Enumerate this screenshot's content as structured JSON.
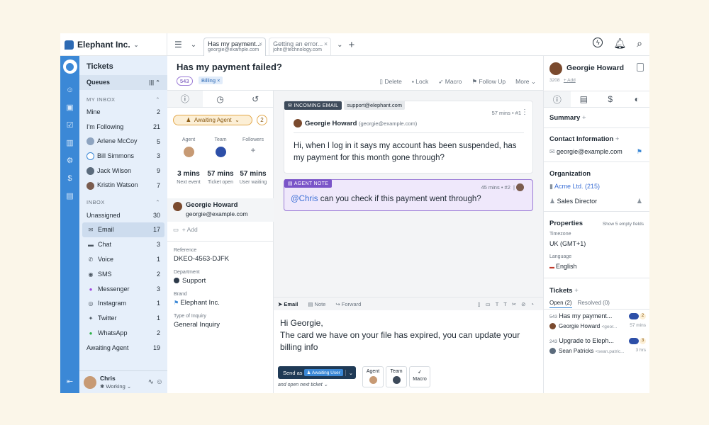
{
  "workspace": {
    "name": "Elephant Inc."
  },
  "tabs": [
    {
      "title": "Has my payment...",
      "subtitle": "georgie@example.com"
    },
    {
      "title": "Getting an error...",
      "subtitle": "john@technology.com"
    }
  ],
  "sidebar": {
    "title": "Tickets",
    "queues_label": "Queues",
    "my_inbox_label": "MY INBOX",
    "my_inbox": [
      {
        "label": "Mine",
        "count": "2"
      },
      {
        "label": "I'm Following",
        "count": "21"
      },
      {
        "label": "Arlene McCoy",
        "count": "5"
      },
      {
        "label": "Bill Simmons",
        "count": "3"
      },
      {
        "label": "Jack Wilson",
        "count": "9"
      },
      {
        "label": "Kristin Watson",
        "count": "7"
      }
    ],
    "inbox_label": "INBOX",
    "inbox": [
      {
        "label": "Unassigned",
        "count": "30"
      },
      {
        "label": "Email",
        "count": "17"
      },
      {
        "label": "Chat",
        "count": "3"
      },
      {
        "label": "Voice",
        "count": "1"
      },
      {
        "label": "SMS",
        "count": "2"
      },
      {
        "label": "Messenger",
        "count": "3"
      },
      {
        "label": "Instagram",
        "count": "1"
      },
      {
        "label": "Twitter",
        "count": "1"
      },
      {
        "label": "WhatsApp",
        "count": "2"
      },
      {
        "label": "Awaiting Agent",
        "count": "19"
      }
    ],
    "agent": {
      "name": "Chris",
      "status": "Working"
    }
  },
  "ticket": {
    "title": "Has my payment failed?",
    "number": "543",
    "tag": "Billing",
    "actions": [
      "Delete",
      "Lock",
      "Macro",
      "Follow Up",
      "More"
    ]
  },
  "detail": {
    "status": "Awaiting Agent",
    "status_count": "2",
    "agent_label": "Agent",
    "team_label": "Team",
    "followers_label": "Followers",
    "stats": [
      {
        "value": "3 mins",
        "label": "Next event"
      },
      {
        "value": "57 mins",
        "label": "Ticket open"
      },
      {
        "value": "57 mins",
        "label": "User waiting"
      }
    ],
    "contact_name": "Georgie Howard",
    "contact_email": "georgie@example.com",
    "add_label": "Add",
    "fields": [
      {
        "label": "Reference",
        "value": "DKEO-4563-DJFK"
      },
      {
        "label": "Department",
        "value": "Support"
      },
      {
        "label": "Brand",
        "value": "Elephant Inc."
      },
      {
        "label": "Type of Inquiry",
        "value": "General Inquiry"
      }
    ]
  },
  "messages": [
    {
      "badge": "INCOMING EMAIL",
      "to": "support@elephant.com",
      "meta": "57 mins",
      "num": "#1",
      "author": "Georgie Howard",
      "author_email": "(georgie@example.com)",
      "body": "Hi, when I log in it says my account has been suspended, has my payment for this month gone through?"
    },
    {
      "badge": "AGENT NOTE",
      "meta": "45 mins",
      "num": "#2",
      "mention": "@Chris",
      "body": " can you check if this payment went through?"
    }
  ],
  "compose": {
    "tabs": [
      "Email",
      "Note",
      "Forward"
    ],
    "lines": [
      "Hi Georgie,",
      "The card we have on your file has expired, you can update your",
      "billing info"
    ],
    "send_label": "Send as",
    "send_status": "Awaiting User",
    "next_label": "and open next ticket",
    "agent_label": "Agent",
    "team_label": "Team",
    "macro_label": "Macro"
  },
  "right": {
    "name": "Georgie Howard",
    "id": "3208",
    "add_label": "+ Add",
    "summary": "Summary",
    "contact_info": "Contact Information",
    "email": "georgie@example.com",
    "organization": "Organization",
    "org_name": "Acme Ltd. (215)",
    "role": "Sales Director",
    "properties": "Properties",
    "show_empty": "Show 5 empty fields",
    "timezone_label": "Timezone",
    "timezone": "UK (GMT+1)",
    "language_label": "Language",
    "language": "English",
    "tickets": "Tickets",
    "open_tab": "Open (2)",
    "resolved_tab": "Resolved (0)",
    "ticket_list": [
      {
        "num": "543",
        "title": "Has my payment...",
        "count": "2",
        "user": "Georgie Howard",
        "email": "<geor...",
        "time": "57 mins"
      },
      {
        "num": "243",
        "title": "Upgrade to Eleph...",
        "count": "3",
        "user": "Sean Patricks",
        "email": "<sean.patric...",
        "time": "3 hrs"
      }
    ]
  }
}
